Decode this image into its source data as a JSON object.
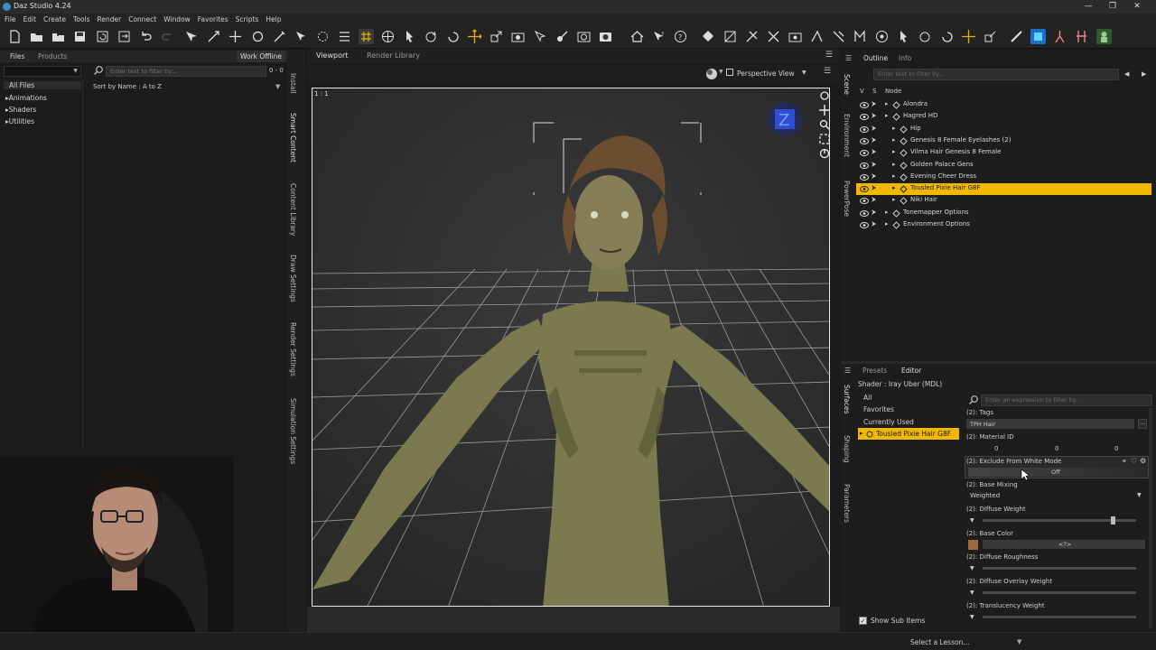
{
  "window": {
    "title": "Daz Studio 4.24",
    "controls": [
      "—",
      "❐",
      "✕"
    ]
  },
  "menu": [
    "File",
    "Edit",
    "Create",
    "Tools",
    "Render",
    "Connect",
    "Window",
    "Favorites",
    "Scripts",
    "Help"
  ],
  "left_panel": {
    "tabs": [
      "Files",
      "Products"
    ],
    "work_offline": "Work Offline",
    "filter_placeholder": "Enter text to filter by...",
    "count": "0 - 0",
    "sort": "Sort by Name : A to Z",
    "tree": [
      {
        "label": "All Files",
        "selected": true
      },
      {
        "label": "Animations",
        "arrow": "▸"
      },
      {
        "label": "Shaders",
        "arrow": "▸"
      },
      {
        "label": "Utilities",
        "arrow": "▸"
      }
    ],
    "vertical_tabs": [
      "Install",
      "Smart Content",
      "Content Library",
      "Draw Settings",
      "Render Settings",
      "Simulation Settings"
    ]
  },
  "viewport": {
    "tabs": [
      "Viewport",
      "Render Library"
    ],
    "camera": "Perspective View",
    "ratio_label": "1 : 1",
    "gizmo_label": "Z"
  },
  "scene": {
    "tabs": [
      "Outline",
      "Info"
    ],
    "filter_placeholder": "Enter text to filter by...",
    "columns": [
      "V",
      "S",
      "Node"
    ],
    "vertical_tabs": [
      "Scene",
      "Environment",
      "PowerPose"
    ],
    "nodes": [
      {
        "label": "Alondra",
        "indent": 0,
        "selected": false
      },
      {
        "label": "Hagred HD",
        "indent": 0,
        "selected": false
      },
      {
        "label": "Hip",
        "indent": 1,
        "selected": false
      },
      {
        "label": "Genesis 8 Female Eyelashes (2)",
        "indent": 1,
        "selected": false
      },
      {
        "label": "Vilma Hair Genesis 8 Female",
        "indent": 1,
        "selected": false
      },
      {
        "label": "Golden Palace Gens",
        "indent": 1,
        "selected": false
      },
      {
        "label": "Evening Cheer Dress",
        "indent": 1,
        "selected": false
      },
      {
        "label": "Tousled Pixie Hair G8F",
        "indent": 1,
        "selected": true
      },
      {
        "label": "Niki Hair",
        "indent": 1,
        "selected": false
      },
      {
        "label": "Tonemapper Options",
        "indent": 0,
        "selected": false
      },
      {
        "label": "Environment Options",
        "indent": 0,
        "selected": false
      }
    ]
  },
  "surfaces": {
    "tabs": [
      "Presets",
      "Editor"
    ],
    "shader": "Shader : Iray Uber (MDL)",
    "vertical_tabs": [
      "Surfaces",
      "Shaping",
      "Parameters"
    ],
    "groups": [
      {
        "label": "All",
        "selected": false
      },
      {
        "label": "Favorites",
        "selected": false
      },
      {
        "label": "Currently Used",
        "selected": false
      },
      {
        "label": "Tousled Pixie Hair G8F",
        "selected": true
      }
    ],
    "show_sub_items": "Show Sub Items",
    "filter_placeholder": "Enter an expression to filter by...",
    "properties": [
      {
        "label": "(2): Tags",
        "value": "TPH Hair"
      },
      {
        "label": "(2): Material ID",
        "values": [
          "0",
          "0",
          "0"
        ]
      },
      {
        "label": "(2): Exclude From White Mode",
        "value": "Off"
      },
      {
        "label": "(2): Base Mixing",
        "value": "Weighted"
      },
      {
        "label": "(2): Diffuse Weight",
        "value": ""
      },
      {
        "label": "(2): Base Color",
        "value": "<?>"
      },
      {
        "label": "(2): Diffuse Roughness",
        "value": ""
      },
      {
        "label": "(2): Diffuse Overlay Weight",
        "value": ""
      },
      {
        "label": "(2): Translucency Weight",
        "value": ""
      }
    ]
  },
  "status": {
    "lesson": "Select a Lesson..."
  },
  "colors": {
    "selection": "#f0b800",
    "accent_blue": "#2f6fcf"
  }
}
